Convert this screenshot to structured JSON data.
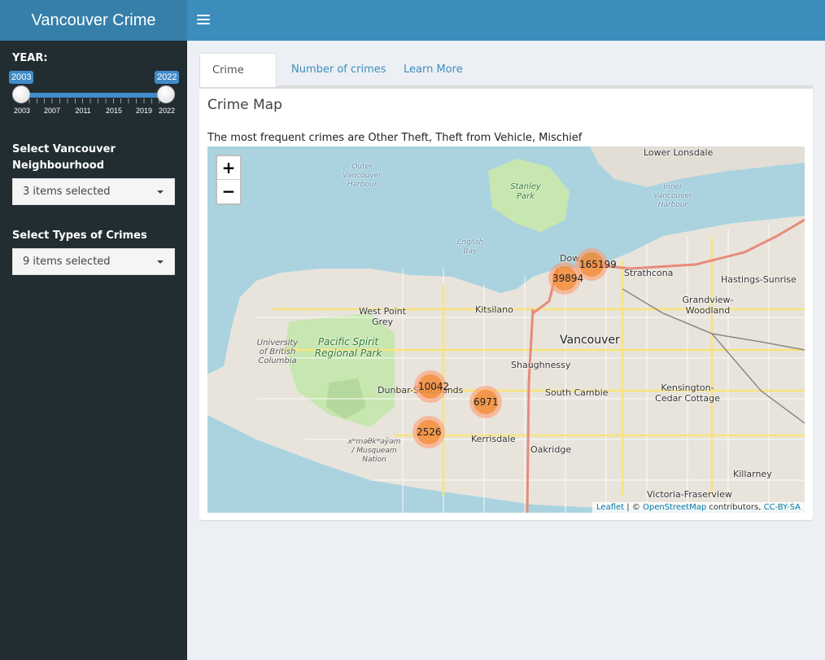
{
  "header": {
    "title": "Vancouver Crime"
  },
  "sidebar": {
    "year": {
      "label": "YEAR:",
      "from": "2003",
      "to": "2022",
      "ticks": [
        "2003",
        "2007",
        "2011",
        "2015",
        "2019",
        "2022"
      ]
    },
    "neighbourhood": {
      "label": "Select Vancouver Neighbourhood",
      "value": "3 items selected"
    },
    "crime_types": {
      "label": "Select Types of Crimes",
      "value": "9 items selected"
    }
  },
  "tabs": [
    {
      "label": "Crime Map",
      "active": true
    },
    {
      "label": "Number of crimes",
      "active": false
    },
    {
      "label": "Learn More",
      "active": false
    }
  ],
  "panel": {
    "title": "Crime Map",
    "subtitle": "The most frequent crimes are Other Theft, Theft from Vehicle, Mischief"
  },
  "map": {
    "zoom_in": "+",
    "zoom_out": "−",
    "clusters": [
      {
        "label": "165199"
      },
      {
        "label": "39894"
      },
      {
        "label": "10042"
      },
      {
        "label": "6971"
      },
      {
        "label": "2526"
      }
    ],
    "places": {
      "lower_lonsdale": "Lower Lonsdale",
      "outer_harbour": "Outer Vancouver Harbour",
      "inner_harbour": "Inner Vancouver Harbour",
      "stanley_park": "Stanley Park",
      "english_bay": "English Bay",
      "downtown": "Dow",
      "strathcona": "Strathcona",
      "hastings": "Hastings-Sunrise",
      "grandview": "Grandview-Woodland",
      "west_point_grey": "West Point Grey",
      "kitsilano": "Kitsilano",
      "vancouver": "Vancouver",
      "ubc": "University of British Columbia",
      "pacific_spirit": "Pacific Spirit Regional Park",
      "shaughnessy": "Shaughnessy",
      "dunbar": "Dunbar-Southlands",
      "south_cambie": "South Cambie",
      "kensington": "Kensington-Cedar Cottage",
      "kerrisdale": "Kerrisdale",
      "oakridge": "Oakridge",
      "musqueam": "xʷməθkʷəy̓əm / Musqueam Nation",
      "killarney": "Killarney",
      "victoria_fraserview": "Victoria-Fraserview"
    },
    "attribution": {
      "leaflet": "Leaflet",
      "sep": " | © ",
      "osm": "OpenStreetMap",
      "contrib": " contributors, ",
      "license": "CC-BY-SA"
    }
  }
}
